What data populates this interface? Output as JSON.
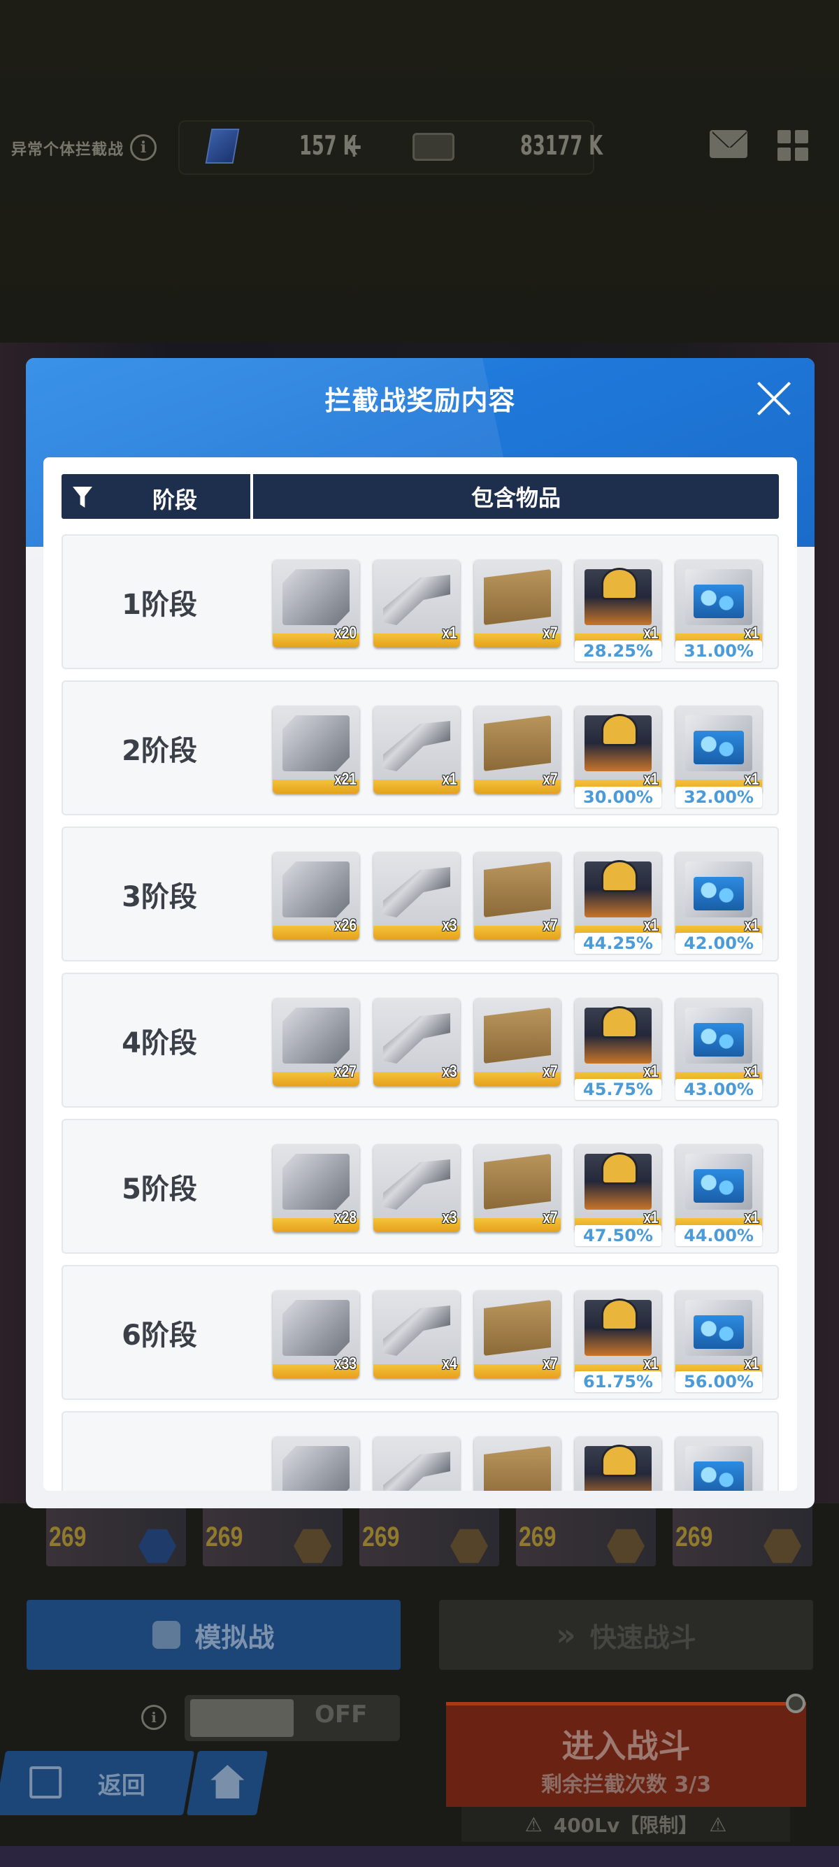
{
  "background": {
    "event_title": "异常个体拦截战",
    "currency_1": "157 K",
    "currency_1_plus": "+",
    "currency_2": "83177 K",
    "hero_levels": [
      "269",
      "269",
      "269",
      "269",
      "269"
    ],
    "sim_battle_label": "模拟战",
    "quick_battle_label": "快速战斗",
    "toggle_off_label": "OFF",
    "back_label": "返回",
    "enter_battle_label": "进入战斗",
    "remaining_label": "剩余拦截次数 3/3",
    "limit_label": "400Lv【限制】"
  },
  "modal": {
    "title": "拦截战奖励内容",
    "col_stage": "阶段",
    "col_items": "包含物品"
  },
  "rows": [
    {
      "label": "1阶段",
      "items": [
        {
          "icon": "silver-crate",
          "qty": "x20"
        },
        {
          "icon": "weapon-part",
          "qty": "x1"
        },
        {
          "icon": "wood-crate",
          "qty": "x7"
        },
        {
          "icon": "dark-equipment-box",
          "qty": "x1",
          "pct": "28.25%"
        },
        {
          "icon": "blue-crystal-box",
          "qty": "x1",
          "pct": "31.00%"
        }
      ]
    },
    {
      "label": "2阶段",
      "items": [
        {
          "icon": "silver-crate",
          "qty": "x21"
        },
        {
          "icon": "weapon-part",
          "qty": "x1"
        },
        {
          "icon": "wood-crate",
          "qty": "x7"
        },
        {
          "icon": "dark-equipment-box",
          "qty": "x1",
          "pct": "30.00%"
        },
        {
          "icon": "blue-crystal-box",
          "qty": "x1",
          "pct": "32.00%"
        }
      ]
    },
    {
      "label": "3阶段",
      "items": [
        {
          "icon": "silver-crate",
          "qty": "x26"
        },
        {
          "icon": "weapon-part",
          "qty": "x3"
        },
        {
          "icon": "wood-crate",
          "qty": "x7"
        },
        {
          "icon": "dark-equipment-box",
          "qty": "x1",
          "pct": "44.25%"
        },
        {
          "icon": "blue-crystal-box",
          "qty": "x1",
          "pct": "42.00%"
        }
      ]
    },
    {
      "label": "4阶段",
      "items": [
        {
          "icon": "silver-crate",
          "qty": "x27"
        },
        {
          "icon": "weapon-part",
          "qty": "x3"
        },
        {
          "icon": "wood-crate",
          "qty": "x7"
        },
        {
          "icon": "dark-equipment-box",
          "qty": "x1",
          "pct": "45.75%"
        },
        {
          "icon": "blue-crystal-box",
          "qty": "x1",
          "pct": "43.00%"
        }
      ]
    },
    {
      "label": "5阶段",
      "items": [
        {
          "icon": "silver-crate",
          "qty": "x28"
        },
        {
          "icon": "weapon-part",
          "qty": "x3"
        },
        {
          "icon": "wood-crate",
          "qty": "x7"
        },
        {
          "icon": "dark-equipment-box",
          "qty": "x1",
          "pct": "47.50%"
        },
        {
          "icon": "blue-crystal-box",
          "qty": "x1",
          "pct": "44.00%"
        }
      ]
    },
    {
      "label": "6阶段",
      "items": [
        {
          "icon": "silver-crate",
          "qty": "x33"
        },
        {
          "icon": "weapon-part",
          "qty": "x4"
        },
        {
          "icon": "wood-crate",
          "qty": "x7"
        },
        {
          "icon": "dark-equipment-box",
          "qty": "x1",
          "pct": "61.75%"
        },
        {
          "icon": "blue-crystal-box",
          "qty": "x1",
          "pct": "56.00%"
        }
      ]
    },
    {
      "label": "",
      "items": [
        {
          "icon": "silver-crate",
          "qty": ""
        },
        {
          "icon": "weapon-part",
          "qty": ""
        },
        {
          "icon": "wood-crate",
          "qty": ""
        },
        {
          "icon": "dark-equipment-box",
          "qty": ""
        },
        {
          "icon": "blue-crystal-box",
          "qty": ""
        }
      ]
    }
  ]
}
